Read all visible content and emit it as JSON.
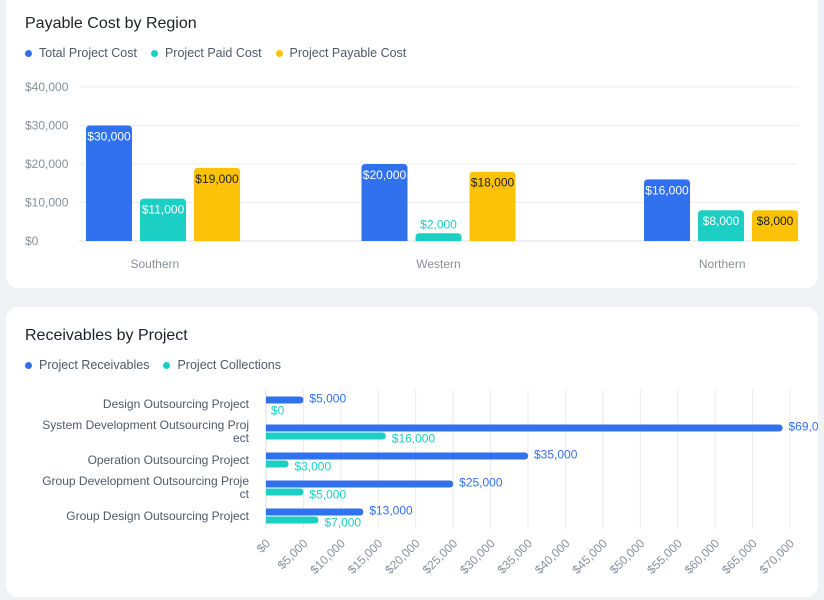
{
  "colors": {
    "total": "#3171ee",
    "paid": "#1ccfc4",
    "payable": "#fcc208",
    "receivables": "#3171ee",
    "collections": "#1ccfc4"
  },
  "chart_data": [
    {
      "type": "bar",
      "title": "Payable Cost by Region",
      "categories": [
        "Southern",
        "Western",
        "Northern"
      ],
      "series": [
        {
          "name": "Total Project Cost",
          "values": [
            30000,
            20000,
            16000
          ],
          "labels": [
            "$30,000",
            "$20,000",
            "$16,000"
          ]
        },
        {
          "name": "Project Paid Cost",
          "values": [
            11000,
            2000,
            8000
          ],
          "labels": [
            "$11,000",
            "$2,000",
            "$8,000"
          ]
        },
        {
          "name": "Project Payable Cost",
          "values": [
            19000,
            18000,
            8000
          ],
          "labels": [
            "$19,000",
            "$18,000",
            "$8,000"
          ]
        }
      ],
      "ylim": [
        0,
        40000
      ],
      "yticks": [
        0,
        10000,
        20000,
        30000,
        40000
      ],
      "ytick_labels": [
        "$0",
        "$10,000",
        "$20,000",
        "$30,000",
        "$40,000"
      ],
      "grid": true,
      "legend": "top-left"
    },
    {
      "type": "bar",
      "orientation": "horizontal",
      "title": "Receivables by Project",
      "categories": [
        "Design Outsourcing Project",
        "System Development Outsourcing Project",
        "Operation Outsourcing Project",
        "Group Development Outsourcing Project",
        "Group Design Outsourcing Project"
      ],
      "category_display": [
        [
          "Design Outsourcing Project"
        ],
        [
          "System Development Outsourcing Proj",
          "ect"
        ],
        [
          "Operation Outsourcing Project"
        ],
        [
          "Group Development Outsourcing Proje",
          "ct"
        ],
        [
          "Group Design Outsourcing Project"
        ]
      ],
      "series": [
        {
          "name": "Project Receivables",
          "values": [
            5000,
            69000,
            35000,
            25000,
            13000
          ],
          "labels": [
            "$5,000",
            "$69,0",
            "$35,000",
            "$25,000",
            "$13,000"
          ]
        },
        {
          "name": "Project Collections",
          "values": [
            0,
            16000,
            3000,
            5000,
            7000
          ],
          "labels": [
            "$0",
            "$16,000",
            "$3,000",
            "$5,000",
            "$7,000"
          ]
        }
      ],
      "xlim": [
        0,
        70000
      ],
      "xticks": [
        0,
        5000,
        10000,
        15000,
        20000,
        25000,
        30000,
        35000,
        40000,
        45000,
        50000,
        55000,
        60000,
        65000,
        70000
      ],
      "xtick_labels": [
        "$0",
        "$5,000",
        "$10,000",
        "$15,000",
        "$20,000",
        "$25,000",
        "$30,000",
        "$35,000",
        "$40,000",
        "$45,000",
        "$50,000",
        "$55,000",
        "$60,000",
        "$65,000",
        "$70,000"
      ],
      "grid": true,
      "legend": "top-left"
    }
  ]
}
